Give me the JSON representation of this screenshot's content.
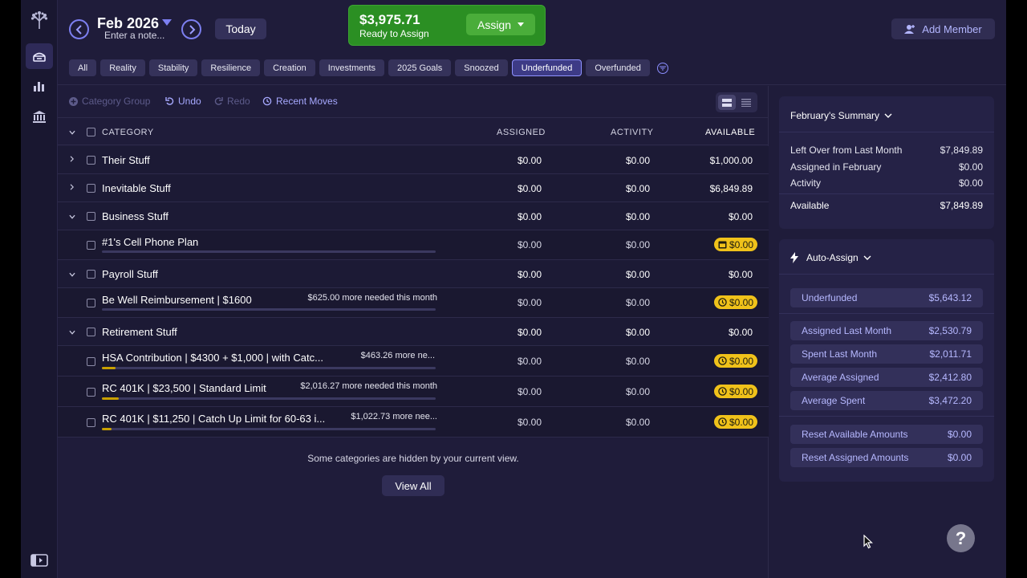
{
  "header": {
    "month": "Feb 2026",
    "note_placeholder": "Enter a note...",
    "today_label": "Today",
    "ready_amount": "$3,975.71",
    "ready_label": "Ready to Assign",
    "assign_label": "Assign",
    "add_member_label": "Add Member"
  },
  "filters": [
    "All",
    "Reality",
    "Stability",
    "Resilience",
    "Creation",
    "Investments",
    "2025 Goals",
    "Snoozed",
    "Underfunded",
    "Overfunded"
  ],
  "selected_filter": "Underfunded",
  "toolbar": {
    "category_group": "Category Group",
    "undo": "Undo",
    "redo": "Redo",
    "recent_moves": "Recent Moves"
  },
  "columns": {
    "category": "CATEGORY",
    "assigned": "ASSIGNED",
    "activity": "ACTIVITY",
    "available": "AVAILABLE"
  },
  "groups": [
    {
      "name": "Their Stuff",
      "assigned": "$0.00",
      "activity": "$0.00",
      "available": "$1,000.00",
      "expanded": false
    },
    {
      "name": "Inevitable Stuff",
      "assigned": "$0.00",
      "activity": "$0.00",
      "available": "$6,849.89",
      "expanded": false
    },
    {
      "name": "Business Stuff",
      "assigned": "$0.00",
      "activity": "$0.00",
      "available": "$0.00",
      "expanded": true
    },
    {
      "name": "Payroll Stuff",
      "assigned": "$0.00",
      "activity": "$0.00",
      "available": "$0.00",
      "expanded": true
    },
    {
      "name": "Retirement Stuff",
      "assigned": "$0.00",
      "activity": "$0.00",
      "available": "$0.00",
      "expanded": true
    }
  ],
  "categories": [
    {
      "name": "#1's Cell Phone Plan",
      "need": "",
      "assigned": "$0.00",
      "activity": "$0.00",
      "available": "$0.00",
      "icon": "calendar-icon",
      "progress": 0
    },
    {
      "name": "Be Well Reimbursement | $1600",
      "need": "$625.00 more needed this month",
      "assigned": "$0.00",
      "activity": "$0.00",
      "available": "$0.00",
      "icon": "clock-icon",
      "progress": 0
    },
    {
      "name": "HSA Contribution | $4300 + $1,000 | with Catc...",
      "need": "$463.26 more ne...",
      "assigned": "$0.00",
      "activity": "$0.00",
      "available": "$0.00",
      "icon": "clock-icon",
      "progress": 0.04
    },
    {
      "name": "RC 401K | $23,500 | Standard Limit",
      "need": "$2,016.27 more needed this month",
      "assigned": "$0.00",
      "activity": "$0.00",
      "available": "$0.00",
      "icon": "clock-icon",
      "progress": 0.05
    },
    {
      "name": "RC 401K | $11,250 | Catch Up Limit for 60-63 i...",
      "need": "$1,022.73 more nee...",
      "assigned": "$0.00",
      "activity": "$0.00",
      "available": "$0.00",
      "icon": "clock-icon",
      "progress": 0.03
    }
  ],
  "hidden_note": "Some categories are hidden by your current view.",
  "view_all_label": "View All",
  "summary": {
    "title": "February's Summary",
    "rows": [
      {
        "label": "Left Over from Last Month",
        "value": "$7,849.89"
      },
      {
        "label": "Assigned in February",
        "value": "$0.00"
      },
      {
        "label": "Activity",
        "value": "$0.00"
      },
      {
        "label": "Available",
        "value": "$7,849.89"
      }
    ]
  },
  "auto_assign": {
    "title": "Auto-Assign",
    "buttons": [
      {
        "label": "Underfunded",
        "value": "$5,643.12"
      },
      {
        "label": "Assigned Last Month",
        "value": "$2,530.79"
      },
      {
        "label": "Spent Last Month",
        "value": "$2,011.71"
      },
      {
        "label": "Average Assigned",
        "value": "$2,412.80"
      },
      {
        "label": "Average Spent",
        "value": "$3,472.20"
      },
      {
        "label": "Reset Available Amounts",
        "value": "$0.00"
      },
      {
        "label": "Reset Assigned Amounts",
        "value": "$0.00"
      }
    ]
  },
  "help_label": "?",
  "colors": {
    "accent": "#7c7ff0",
    "ready_green": "#2b8f23",
    "pill_yellow": "#f0c21a",
    "background": "#1f1c3a"
  }
}
